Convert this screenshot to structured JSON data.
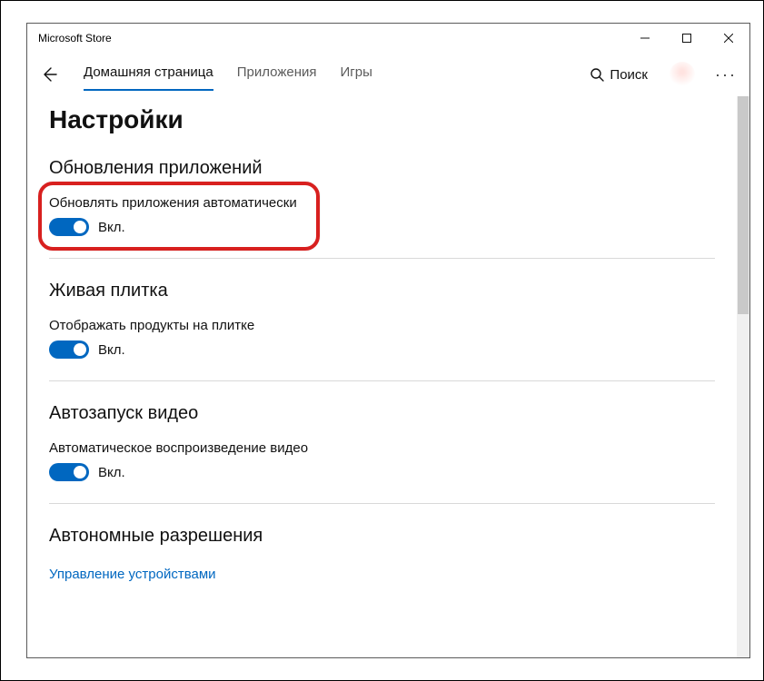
{
  "window": {
    "title": "Microsoft Store"
  },
  "nav": {
    "tabs": [
      {
        "label": "Домашняя страница",
        "active": true
      },
      {
        "label": "Приложения"
      },
      {
        "label": "Игры"
      }
    ],
    "search_label": "Поиск"
  },
  "page": {
    "title": "Настройки"
  },
  "sections": {
    "updates": {
      "title": "Обновления приложений",
      "setting_label": "Обновлять приложения автоматически",
      "toggle_state": "Вкл."
    },
    "live_tile": {
      "title": "Живая плитка",
      "setting_label": "Отображать продукты на плитке",
      "toggle_state": "Вкл."
    },
    "video": {
      "title": "Автозапуск видео",
      "setting_label": "Автоматическое воспроизведение видео",
      "toggle_state": "Вкл."
    },
    "offline": {
      "title": "Автономные разрешения",
      "link": "Управление устройствами"
    }
  }
}
